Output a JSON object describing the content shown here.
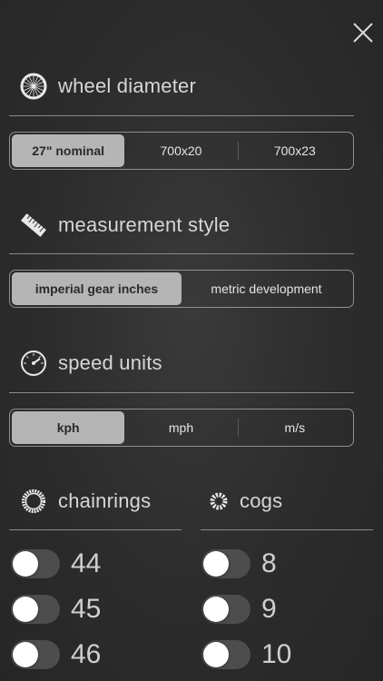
{
  "close_icon": "close-icon",
  "wheel": {
    "title": "wheel diameter",
    "icon": "wheel-icon",
    "options": [
      {
        "label": "27\" nominal",
        "selected": true
      },
      {
        "label": "700x20",
        "selected": false
      },
      {
        "label": "700x23",
        "selected": false
      }
    ]
  },
  "measurement": {
    "title": "measurement style",
    "icon": "ruler-icon",
    "options": [
      {
        "label": "imperial gear inches",
        "selected": true
      },
      {
        "label": "metric development",
        "selected": false
      }
    ]
  },
  "speed": {
    "title": "speed units",
    "icon": "speedometer-icon",
    "options": [
      {
        "label": "kph",
        "selected": true
      },
      {
        "label": "mph",
        "selected": false
      },
      {
        "label": "m/s",
        "selected": false
      }
    ]
  },
  "chainrings": {
    "title": "chainrings",
    "icon": "chainring-icon",
    "items": [
      {
        "value": "44",
        "on": false
      },
      {
        "value": "45",
        "on": false
      },
      {
        "value": "46",
        "on": false
      }
    ]
  },
  "cogs": {
    "title": "cogs",
    "icon": "cog-icon",
    "items": [
      {
        "value": "8",
        "on": false
      },
      {
        "value": "9",
        "on": false
      },
      {
        "value": "10",
        "on": false
      }
    ]
  },
  "colors": {
    "selected_segment": "#b5b5b5",
    "background": "#2e2e2e"
  }
}
